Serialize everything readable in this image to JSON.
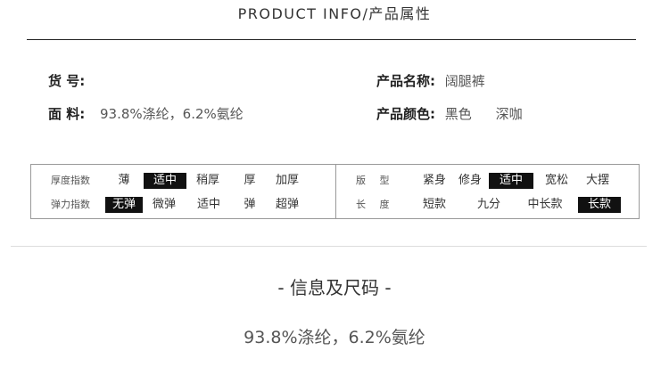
{
  "header": {
    "title_en": "PRODUCT INFO/",
    "title_cn": "产品属性"
  },
  "specs": {
    "item_no": {
      "label": "货  号:",
      "value": ""
    },
    "product_name": {
      "label": "产品名称:",
      "value": "阔腿裤"
    },
    "material": {
      "label": "面  料:",
      "value": "93.8%涤纶，6.2%氨纶"
    },
    "colors": {
      "label": "产品颜色:",
      "values": [
        "黑色",
        "深咖"
      ]
    }
  },
  "attributes": {
    "thickness": {
      "label": "厚度指数",
      "options": [
        "薄",
        "适中",
        "稍厚",
        "厚",
        "加厚"
      ],
      "selected": "适中"
    },
    "elasticity": {
      "label": "弹力指数",
      "options": [
        "无弹",
        "微弹",
        "适中",
        "弹",
        "超弹"
      ],
      "selected": "无弹"
    },
    "fit": {
      "label": "版  型",
      "options": [
        "紧身",
        "修身",
        "适中",
        "宽松",
        "大摆"
      ],
      "selected": "适中"
    },
    "length": {
      "label": "长  度",
      "options": [
        "短款",
        "九分",
        "中长款",
        "长款"
      ],
      "selected": "长款"
    }
  },
  "size_info": {
    "title": "- 信息及尺码 -",
    "text": "93.8%涤纶，6.2%氨纶"
  }
}
